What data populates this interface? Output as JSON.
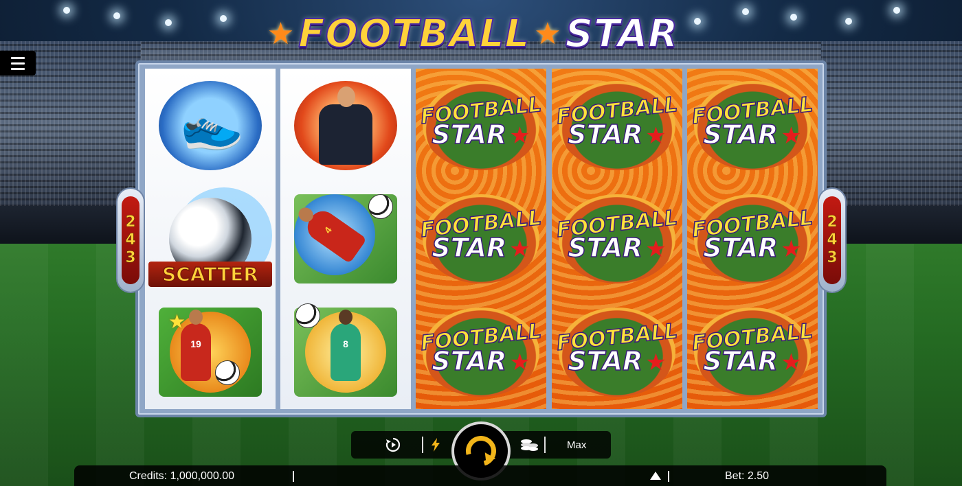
{
  "game": {
    "logo_part1": "FOOTBALL",
    "logo_part2": "STAR",
    "ways_left": [
      "2",
      "4",
      "3"
    ],
    "ways_right": [
      "2",
      "4",
      "3"
    ]
  },
  "reels": {
    "reel1": [
      "boots",
      "scatter",
      "striker-19"
    ],
    "reel2": [
      "referee",
      "bicycle-kick-4",
      "header-8"
    ],
    "reel3": [
      "football-star-wild",
      "football-star-wild",
      "football-star-wild"
    ],
    "reel4": [
      "football-star-wild",
      "football-star-wild",
      "football-star-wild"
    ],
    "reel5": [
      "football-star-wild",
      "football-star-wild",
      "football-star-wild"
    ],
    "scatter_label": "SCATTER",
    "wild_line1": "FOOTBALL",
    "wild_line2": "STAR",
    "jersey_numbers": [
      "19",
      "4",
      "8"
    ]
  },
  "controls": {
    "autoplay_icon": "autoplay-icon",
    "turbo_icon": "lightning-icon",
    "spin_icon": "spin-icon",
    "coins_icon": "coins-icon",
    "max_label": "Max"
  },
  "infobar": {
    "credits": "Credits: 1,000,000.00",
    "bet": "Bet: 2.50"
  },
  "colors": {
    "accent": "#f2b51a",
    "reel_orange": "#e65a0a",
    "ways_red": "#c21a12"
  }
}
